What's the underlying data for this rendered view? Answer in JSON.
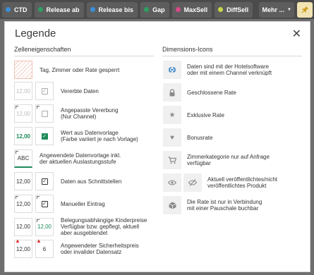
{
  "toolbar": {
    "buttons": [
      {
        "label": "CTD",
        "color": "#3a8fd9"
      },
      {
        "label": "Release ab",
        "color": "#2e9e62"
      },
      {
        "label": "Release bis",
        "color": "#3a8fd9"
      },
      {
        "label": "Gap",
        "color": "#2e9e62"
      },
      {
        "label": "MaxSell",
        "color": "#d74a8a"
      },
      {
        "label": "DiffSell",
        "color": "#c8d84a"
      }
    ],
    "more_label": "Mehr ...",
    "pin_icon": "pin-icon"
  },
  "modal": {
    "title": "Legende",
    "close_icon": "close-icon",
    "left_title": "Zelleneigenschaften",
    "right_title": "Dimensions-Icons",
    "left_rows": [
      {
        "text": "Tag, Zimmer oder Rate gesperrt"
      },
      {
        "value": "12,00",
        "text": "Vererbte Daten"
      },
      {
        "value": "12,00",
        "text": "Angepasste Vererbung\n(Nur Channel)"
      },
      {
        "value": "12,00",
        "text": "Wert aus Datenvorlage\n(Farbe variiert je nach Vorlage)"
      },
      {
        "value": "ABC",
        "text": "Angewendete Datenvorlage inkl.\nder aktuellen Auslastungsstufe"
      },
      {
        "value": "12,00",
        "text": "Daten aus Schnittstellen"
      },
      {
        "value": "12,00",
        "text": "Manueller Eintrag"
      },
      {
        "value": "12,00",
        "value2": "12,00",
        "text": "Belegungsabhängige Kinderpreise\nVerfügbar bzw. gepflegt, aktuell\naber ausgeblendet"
      },
      {
        "value": "12,00",
        "value2": "6",
        "text": "Angewendeter Sicherheitspreis\noder invalider Datensatz"
      }
    ],
    "right_rows": [
      {
        "icon": "link-icon",
        "text": "Daten sind mit der Hotelsoftware\noder mit einem Channel verknüpft"
      },
      {
        "icon": "lock-icon",
        "text": "Geschlossene Rate"
      },
      {
        "icon": "star-icon",
        "text": "Exklusive Rate"
      },
      {
        "icon": "heart-icon",
        "text": "Bonusrate"
      },
      {
        "icon": "cart-icon",
        "text": "Zimmerkategorie nur auf Anfrage\nverfügbar"
      },
      {
        "icon": "eye-icon",
        "icon2": "eye-off-icon",
        "text": "Aktuell veröffentlichtes/nicht\nveröffentlichtes Produkt"
      },
      {
        "icon": "box-icon",
        "text": "Die Rate ist nur in Verbindung\nmit einer Pauschale buchbar"
      }
    ]
  }
}
